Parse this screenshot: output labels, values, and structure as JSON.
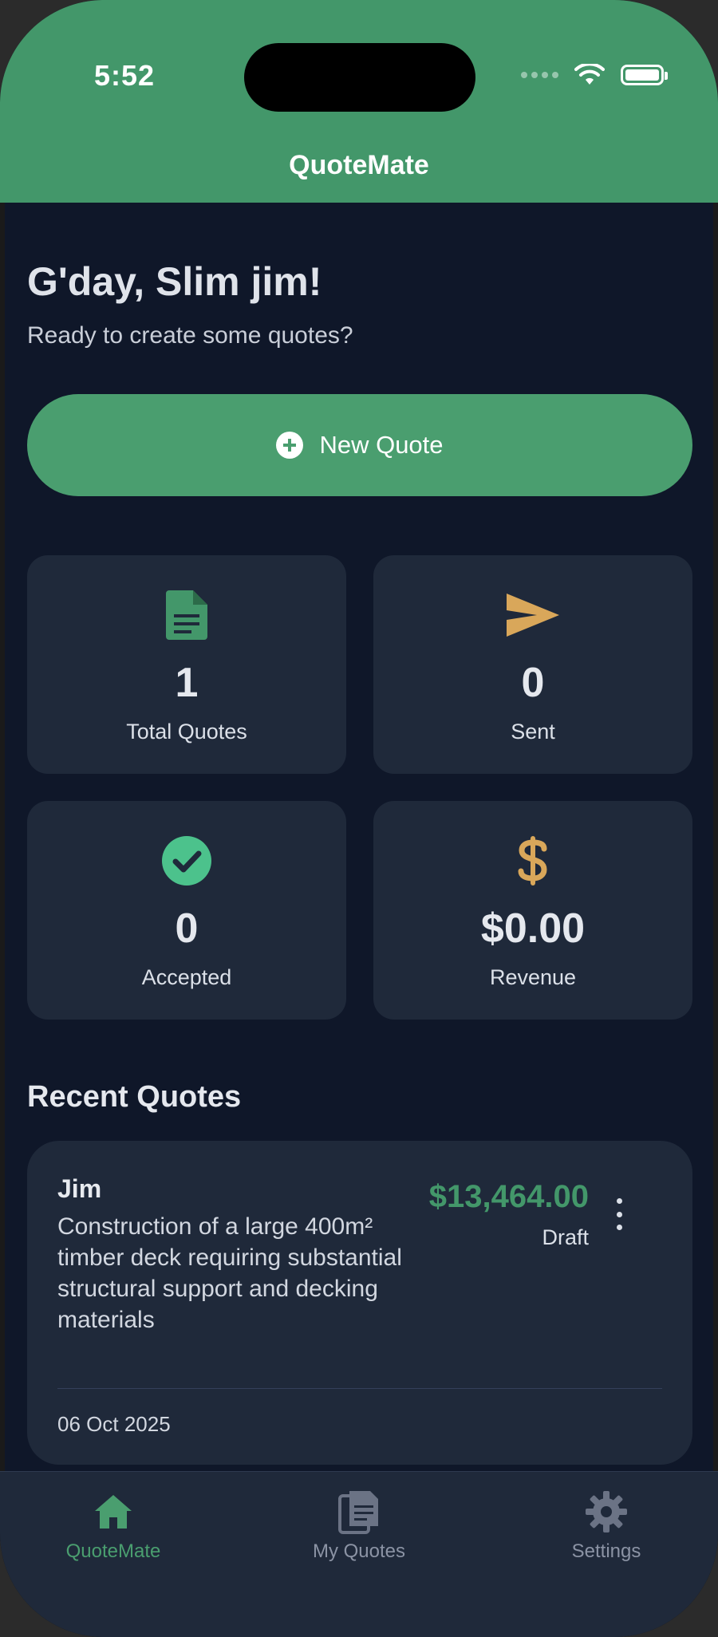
{
  "status_bar": {
    "time": "5:52"
  },
  "header": {
    "title": "QuoteMate"
  },
  "greeting": {
    "title": "G'day, Slim jim!",
    "subtitle": "Ready to create some quotes?"
  },
  "new_quote": {
    "label": "New Quote",
    "icon": "plus-circle-icon"
  },
  "stats": [
    {
      "value": "1",
      "label": "Total Quotes",
      "icon": "document-icon",
      "color": "#43976a"
    },
    {
      "value": "0",
      "label": "Sent",
      "icon": "send-icon",
      "color": "#d9a75a"
    },
    {
      "value": "0",
      "label": "Accepted",
      "icon": "check-circle-icon",
      "color": "#4cc28c"
    },
    {
      "value": "$0.00",
      "label": "Revenue",
      "icon": "dollar-icon",
      "color": "#d9a75a"
    }
  ],
  "recent": {
    "title": "Recent Quotes",
    "items": [
      {
        "client": "Jim",
        "description": "Construction of a large 400m² timber deck requiring substantial structural support and decking materials",
        "amount": "$13,464.00",
        "status": "Draft",
        "date": "06 Oct 2025"
      }
    ]
  },
  "tabs": [
    {
      "label": "QuoteMate",
      "icon": "home-icon",
      "active": true
    },
    {
      "label": "My Quotes",
      "icon": "documents-icon",
      "active": false
    },
    {
      "label": "Settings",
      "icon": "gear-icon",
      "active": false
    }
  ],
  "colors": {
    "accent": "#43976a",
    "background": "#0f1729",
    "card": "#1f293a"
  }
}
